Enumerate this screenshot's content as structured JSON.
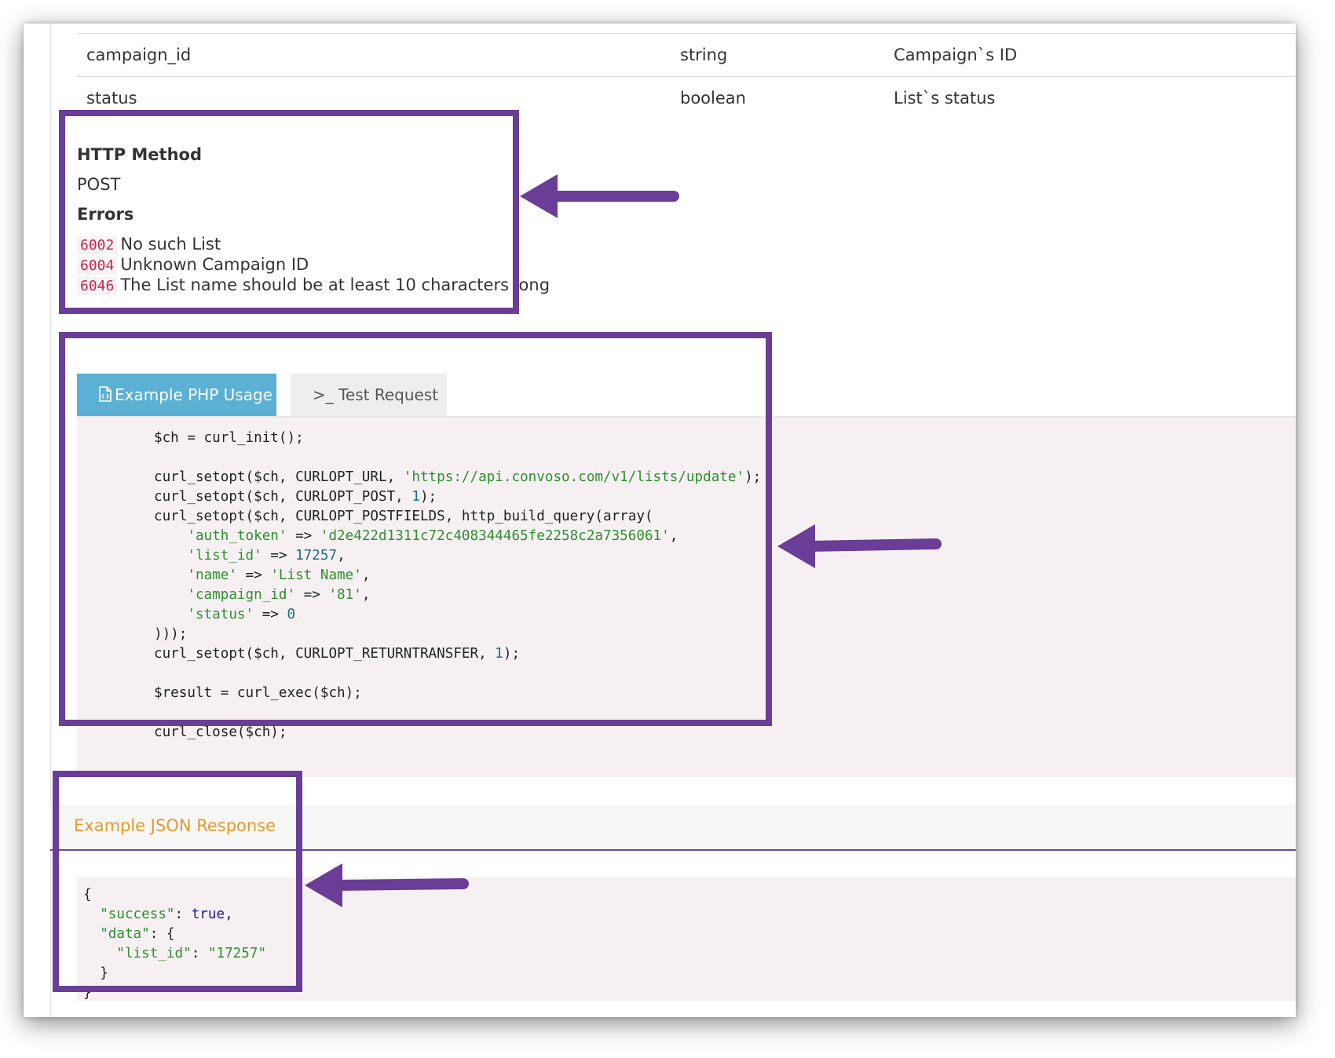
{
  "params": [
    {
      "name": "campaign_id",
      "type": "string",
      "description": "Campaign`s ID"
    },
    {
      "name": "status",
      "type": "boolean",
      "description": "List`s status"
    }
  ],
  "http_method": {
    "heading": "HTTP Method",
    "value": "POST"
  },
  "errors": {
    "heading": "Errors",
    "items": [
      {
        "code": "6002",
        "message": "No such List"
      },
      {
        "code": "6004",
        "message": "Unknown Campaign ID"
      },
      {
        "code": "6046",
        "message": "The List name should be at least 10 characters long"
      }
    ]
  },
  "tabs": {
    "php_usage": {
      "label": "Example PHP Usage",
      "icon": "file-code-icon"
    },
    "test_request": {
      "label": ">_ Test Request",
      "icon": "terminal-icon"
    }
  },
  "php_code": {
    "line1": "$ch = curl_init();",
    "line2_a": "curl_setopt($ch, CURLOPT_URL, ",
    "line2_url": "'https://api.convoso.com/v1/lists/update'",
    "line2_b": ");",
    "line3_a": "curl_setopt($ch, CURLOPT_POST, ",
    "line3_n": "1",
    "line3_b": ");",
    "line4": "curl_setopt($ch, CURLOPT_POSTFIELDS, http_build_query(array(",
    "auth_key": "'auth_token'",
    "auth_val": "'d2e422d1311c72c408344465fe2258c2a7356061'",
    "list_key": "'list_id'",
    "list_val": "17257",
    "name_key": "'name'",
    "name_val": "'List Name'",
    "camp_key": "'campaign_id'",
    "camp_val": "'81'",
    "status_key": "'status'",
    "status_val": "0",
    "close_array": ")));",
    "line_return_a": "curl_setopt($ch, CURLOPT_RETURNTRANSFER, ",
    "line_return_n": "1",
    "line_return_b": ");",
    "line_exec": "$result = curl_exec($ch);",
    "line_close": "curl_close($ch);"
  },
  "json_response": {
    "title": "Example JSON Response",
    "open": "{",
    "success_key": "\"success\"",
    "success_val": "true",
    "data_key": "\"data\"",
    "list_id_key": "\"list_id\"",
    "list_id_val": "\"17257\"",
    "inner_close": "}",
    "close": "}"
  },
  "colors": {
    "highlight": "#6a3d96",
    "tab_active": "#5bb0d3",
    "json_title": "#e39a2c",
    "error_code": "#c7254e"
  }
}
